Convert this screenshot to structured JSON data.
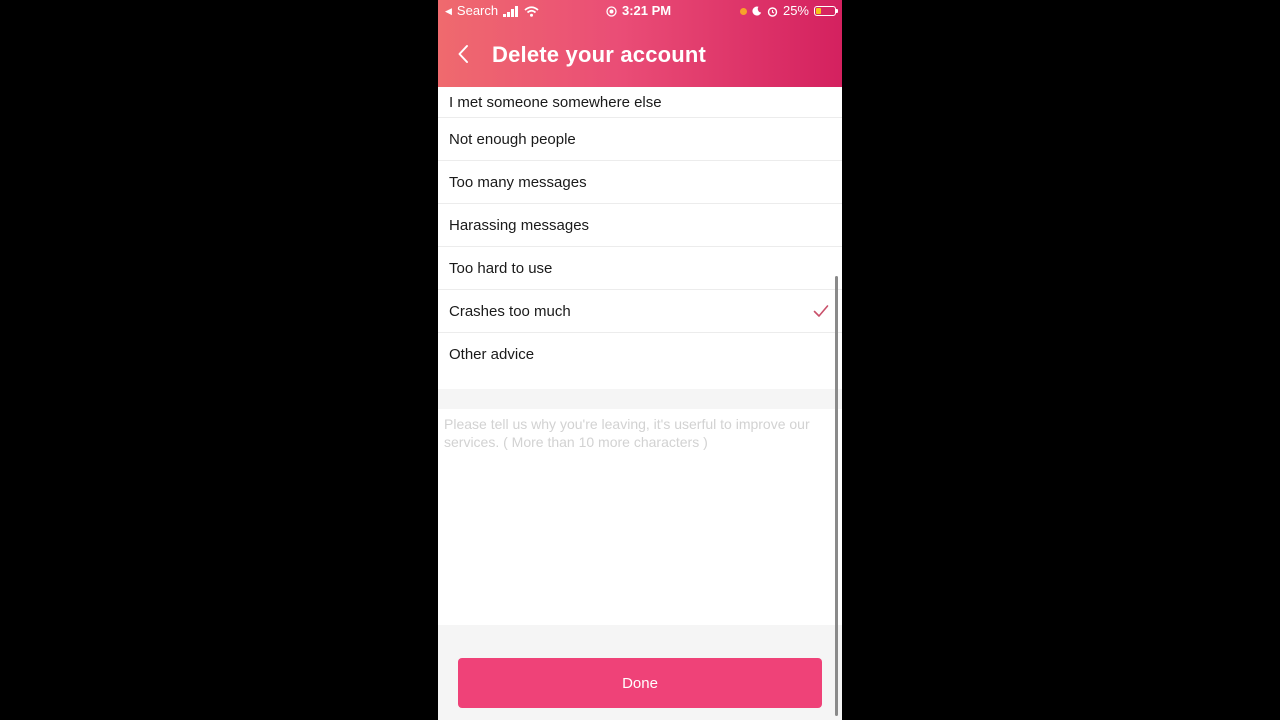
{
  "status_bar": {
    "back_app": "Search",
    "time": "3:21 PM",
    "battery": "25%"
  },
  "nav": {
    "title": "Delete your account"
  },
  "reasons": [
    {
      "label": "I met someone somewhere else",
      "selected": false
    },
    {
      "label": "Not enough people",
      "selected": false
    },
    {
      "label": "Too many messages",
      "selected": false
    },
    {
      "label": "Harassing messages",
      "selected": false
    },
    {
      "label": "Too hard to use",
      "selected": false
    },
    {
      "label": "Crashes too much",
      "selected": true
    },
    {
      "label": "Other advice",
      "selected": false
    }
  ],
  "feedback": {
    "placeholder": "Please tell us why you're leaving, it's userful to improve our services. ( More than 10 more characters )",
    "value": ""
  },
  "footer": {
    "done_label": "Done"
  },
  "colors": {
    "accent": "#ef4278",
    "check": "#c9506a"
  }
}
